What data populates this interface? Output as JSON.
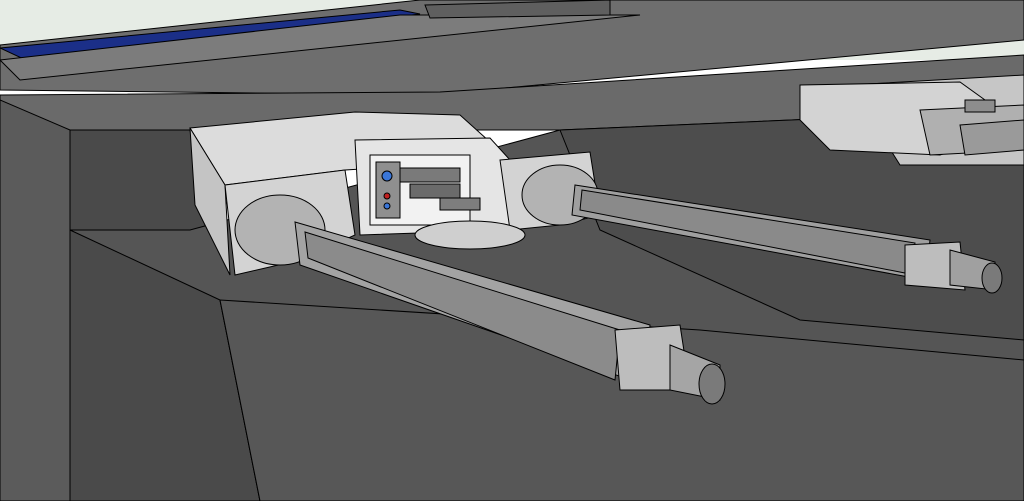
{
  "scene": {
    "description_visible_text": "",
    "colors": {
      "sky": "#e6ece5",
      "hull_dark": "#545454",
      "hull_mid": "#6b6b6b",
      "hull_light": "#8a8a8a",
      "deck": "#4f4f4f",
      "turret_light": "#d9d9d9",
      "turret_mid": "#bdbdbd",
      "turret_shadow": "#9d9d9d",
      "barrel_light": "#b8b8b8",
      "barrel_dark": "#7a7a7a",
      "panel_blue": "#1b2f88",
      "edge": "#000000",
      "accent_blue": "#3a76d8",
      "accent_red": "#c02020"
    }
  }
}
